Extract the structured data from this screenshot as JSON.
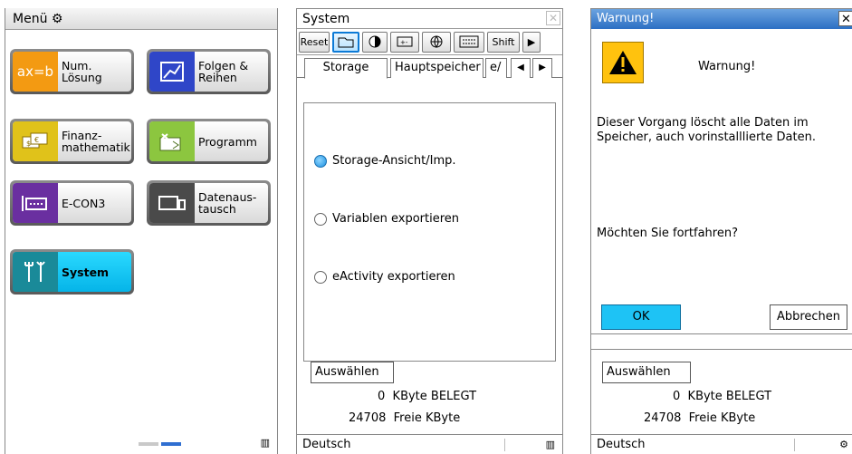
{
  "menu": {
    "title": "Menü",
    "apps": [
      {
        "icon_text": "ax=b",
        "label": "Num.\nLösung",
        "color": "#f39a12"
      },
      {
        "icon_text": "",
        "label": "Folgen &\nReihen",
        "color": "#2f46c8"
      },
      {
        "icon_text": "",
        "label": "Finanz-\nmathematik",
        "color": "#e0c21a"
      },
      {
        "icon_text": "",
        "label": "Programm",
        "color": "#8cc63f"
      },
      {
        "icon_text": "",
        "label": "E-CON3",
        "color": "#6a2fa0"
      },
      {
        "icon_text": "",
        "label": "Datenaus-\ntausch",
        "color": "#4a4a4a"
      },
      {
        "icon_text": "",
        "label": "System",
        "color": "#1a8a99",
        "selected": true
      }
    ]
  },
  "system": {
    "title": "System",
    "toolbar": {
      "reset": "Reset",
      "shift": "Shift"
    },
    "tabs": {
      "storage": "Storage",
      "hauptspeicher": "Hauptspeicher",
      "partial": "e/"
    },
    "options": [
      {
        "label": "Storage-Ansicht/Imp.",
        "selected": true
      },
      {
        "label": "Variablen exportieren",
        "selected": false
      },
      {
        "label": "eActivity exportieren",
        "selected": false
      }
    ],
    "select_button": "Auswählen",
    "used_value": "0",
    "used_label": "KByte BELEGT",
    "free_value": "24708",
    "free_label": "Freie KByte",
    "status_language": "Deutsch"
  },
  "warning": {
    "title": "Warnung!",
    "heading": "Warnung!",
    "message": "Dieser Vorgang löscht alle Daten im Speicher, auch vorinstalllierte Daten.",
    "question": "Möchten Sie fortfahren?",
    "ok": "OK",
    "cancel": "Abbrechen",
    "select_button": "Auswählen",
    "used_value": "0",
    "used_label": "KByte BELEGT",
    "free_value": "24708",
    "free_label": "Freie KByte",
    "status_language": "Deutsch"
  }
}
